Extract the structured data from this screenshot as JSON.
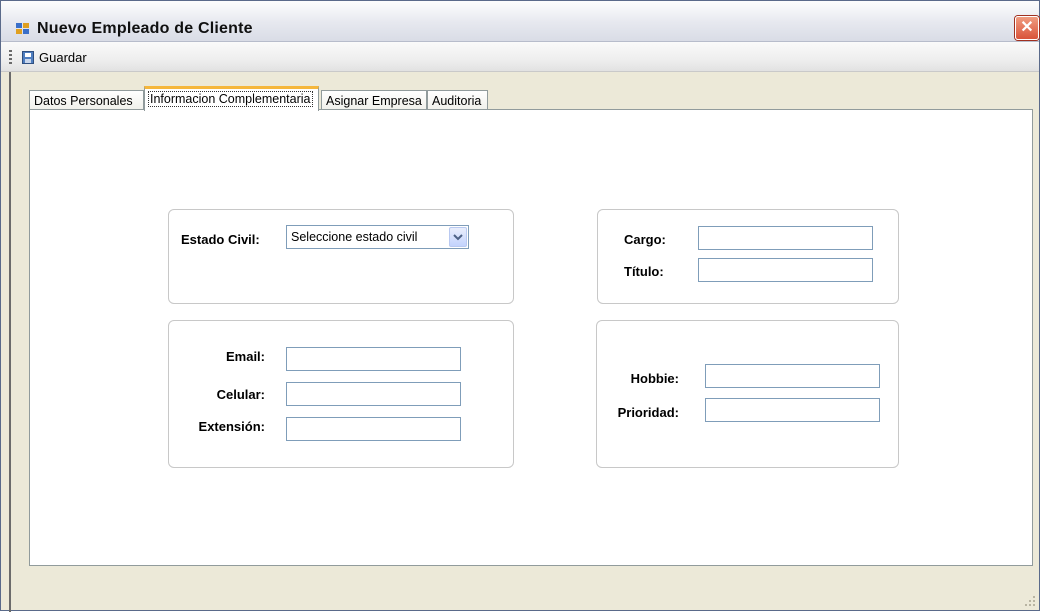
{
  "window": {
    "title": "Nuevo Empleado de Cliente",
    "close_symbol": "✕"
  },
  "toolbar": {
    "save_label": "Guardar"
  },
  "tabs": [
    {
      "label": "Datos Personales",
      "active": false
    },
    {
      "label": "Informacion Complementaria",
      "active": true
    },
    {
      "label": "Asignar Empresa",
      "active": false
    },
    {
      "label": "Auditoria",
      "active": false
    }
  ],
  "form": {
    "estado_civil": {
      "label": "Estado Civil:",
      "selected": "Seleccione estado civil"
    },
    "cargo": {
      "label": "Cargo:",
      "value": ""
    },
    "titulo": {
      "label": "Título:",
      "value": ""
    },
    "email": {
      "label": "Email:",
      "value": ""
    },
    "celular": {
      "label": "Celular:",
      "value": ""
    },
    "extension": {
      "label": "Extensión:",
      "value": ""
    },
    "hobbie": {
      "label": "Hobbie:",
      "value": ""
    },
    "prioridad": {
      "label": "Prioridad:",
      "value": ""
    }
  },
  "colors": {
    "active_tab_accent": "#f5b73c",
    "input_border": "#7f9db9",
    "close_button": "#d9533a"
  }
}
